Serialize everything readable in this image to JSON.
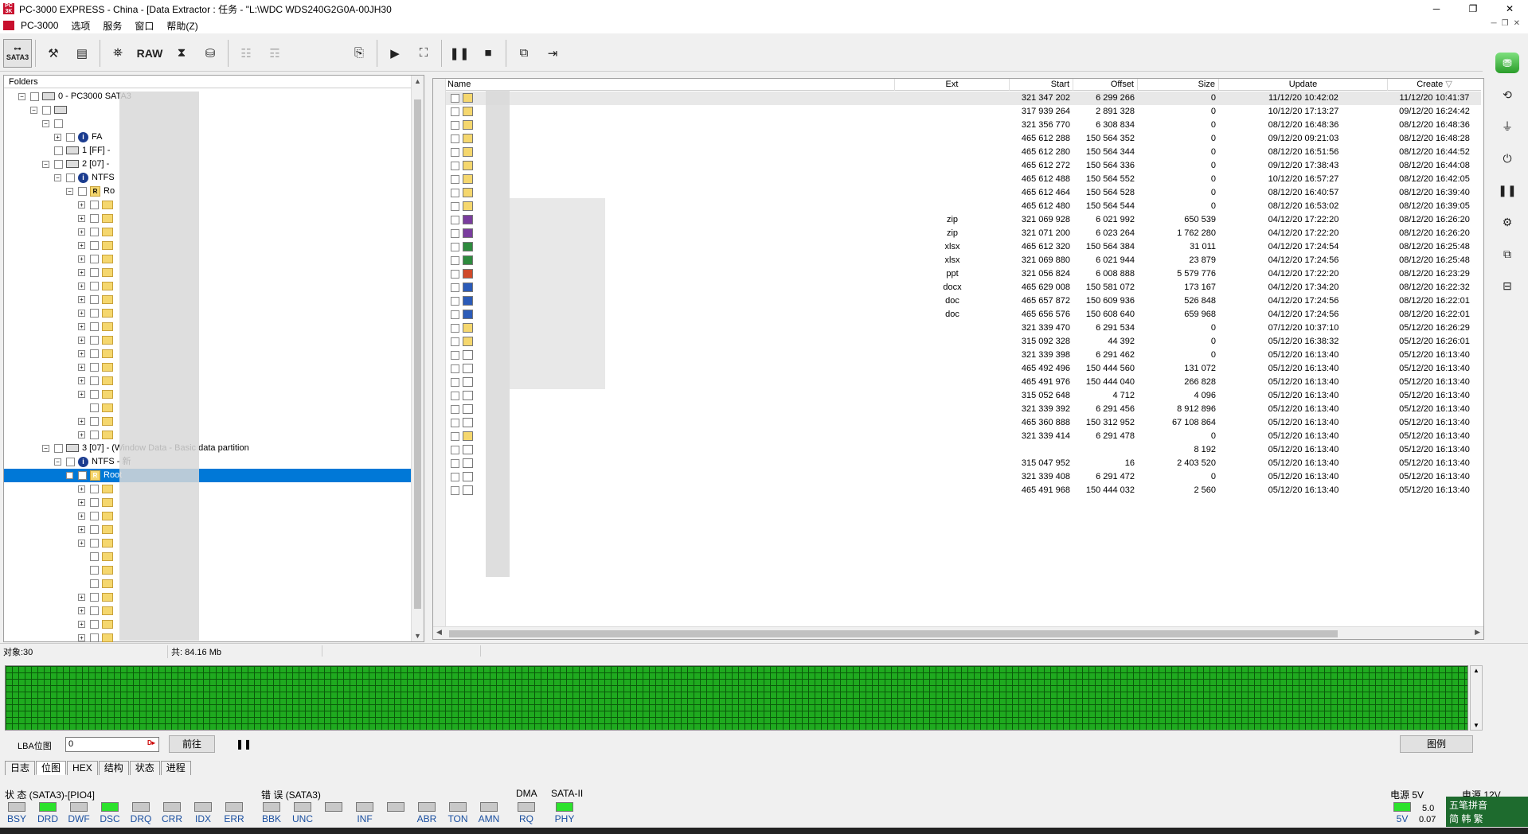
{
  "window": {
    "title": "PC-3000 EXPRESS - China - [Data Extractor : 任务 - \"L:\\WDC WDS240G2G0A-00JH30",
    "min": "─",
    "max": "❐",
    "close": "✕"
  },
  "menu": [
    "PC-3000",
    "选项",
    "服务",
    "窗口",
    "帮助(Z)"
  ],
  "toolbar": {
    "sata_label": "SATA3",
    "raw_label": "RAW"
  },
  "folders": {
    "header": "Folders",
    "rows": [
      {
        "text": "0 - PC3000 SATA3",
        "depth": 0,
        "icon": "disk",
        "exp": "−"
      },
      {
        "text": "",
        "depth": 1,
        "icon": "disk",
        "exp": "−"
      },
      {
        "text": "",
        "depth": 2,
        "icon": "none",
        "exp": "−"
      },
      {
        "text": "FA",
        "depth": 3,
        "icon": "info",
        "exp": "+"
      },
      {
        "text": "1 [FF] -",
        "depth": 2,
        "icon": "disk",
        "exp": ""
      },
      {
        "text": "2 [07] -",
        "depth": 2,
        "icon": "disk",
        "exp": "−"
      },
      {
        "text": "NTFS",
        "depth": 3,
        "icon": "info",
        "exp": "−"
      },
      {
        "text": "Ro",
        "depth": 4,
        "icon": "root",
        "exp": "−"
      }
    ],
    "partition3": "3 [07] - (Window",
    "partition3_tail": "Data - Basic data partition",
    "ntfs2": "NTFS - 新",
    "root_sel": "Root"
  },
  "filelist": {
    "columns": {
      "name": "Name",
      "ext": "Ext",
      "start": "Start",
      "offset": "Offset",
      "size": "Size",
      "update": "Update",
      "create": "Create"
    },
    "rows": [
      {
        "type": "folder",
        "ext": "",
        "start": "321 347 202",
        "offset": "6 299 266",
        "size": "0",
        "update": "11/12/20 10:42:02",
        "create": "11/12/20 10:41:37"
      },
      {
        "type": "folder",
        "ext": "",
        "start": "317 939 264",
        "offset": "2 891 328",
        "size": "0",
        "update": "10/12/20 17:13:27",
        "create": "09/12/20 16:24:42"
      },
      {
        "type": "folder",
        "ext": "",
        "start": "321 356 770",
        "offset": "6 308 834",
        "size": "0",
        "update": "08/12/20 16:48:36",
        "create": "08/12/20 16:48:36"
      },
      {
        "type": "folder",
        "ext": "",
        "start": "465 612 288",
        "offset": "150 564 352",
        "size": "0",
        "update": "09/12/20 09:21:03",
        "create": "08/12/20 16:48:28"
      },
      {
        "type": "folder",
        "ext": "",
        "start": "465 612 280",
        "offset": "150 564 344",
        "size": "0",
        "update": "08/12/20 16:51:56",
        "create": "08/12/20 16:44:52"
      },
      {
        "type": "folder",
        "ext": "",
        "start": "465 612 272",
        "offset": "150 564 336",
        "size": "0",
        "update": "09/12/20 17:38:43",
        "create": "08/12/20 16:44:08"
      },
      {
        "type": "folder",
        "ext": "",
        "start": "465 612 488",
        "offset": "150 564 552",
        "size": "0",
        "update": "10/12/20 16:57:27",
        "create": "08/12/20 16:42:05"
      },
      {
        "type": "folder",
        "ext": "",
        "start": "465 612 464",
        "offset": "150 564 528",
        "size": "0",
        "update": "08/12/20 16:40:57",
        "create": "08/12/20 16:39:40"
      },
      {
        "type": "folder",
        "ext": "",
        "start": "465 612 480",
        "offset": "150 564 544",
        "size": "0",
        "update": "08/12/20 16:53:02",
        "create": "08/12/20 16:39:05"
      },
      {
        "type": "zip",
        "ext": "zip",
        "start": "321 069 928",
        "offset": "6 021 992",
        "size": "650 539",
        "update": "04/12/20 17:22:20",
        "create": "08/12/20 16:26:20"
      },
      {
        "type": "zip",
        "ext": "zip",
        "start": "321 071 200",
        "offset": "6 023 264",
        "size": "1 762 280",
        "update": "04/12/20 17:22:20",
        "create": "08/12/20 16:26:20"
      },
      {
        "type": "xls",
        "ext": "xlsx",
        "start": "465 612 320",
        "offset": "150 564 384",
        "size": "31 011",
        "update": "04/12/20 17:24:54",
        "create": "08/12/20 16:25:48"
      },
      {
        "type": "xls",
        "ext": "xlsx",
        "start": "321 069 880",
        "offset": "6 021 944",
        "size": "23 879",
        "update": "04/12/20 17:24:56",
        "create": "08/12/20 16:25:48"
      },
      {
        "type": "ppt",
        "ext": "ppt",
        "start": "321 056 824",
        "offset": "6 008 888",
        "size": "5 579 776",
        "update": "04/12/20 17:22:20",
        "create": "08/12/20 16:23:29"
      },
      {
        "type": "doc",
        "ext": "docx",
        "start": "465 629 008",
        "offset": "150 581 072",
        "size": "173 167",
        "update": "04/12/20 17:34:20",
        "create": "08/12/20 16:22:32"
      },
      {
        "type": "doc",
        "ext": "doc",
        "start": "465 657 872",
        "offset": "150 609 936",
        "size": "526 848",
        "update": "04/12/20 17:24:56",
        "create": "08/12/20 16:22:01"
      },
      {
        "type": "doc",
        "ext": "doc",
        "start": "465 656 576",
        "offset": "150 608 640",
        "size": "659 968",
        "update": "04/12/20 17:24:56",
        "create": "08/12/20 16:22:01"
      },
      {
        "type": "folder",
        "ext": "",
        "start": "321 339 470",
        "offset": "6 291 534",
        "size": "0",
        "update": "07/12/20 10:37:10",
        "create": "05/12/20 16:26:29"
      },
      {
        "type": "folder",
        "ext": "",
        "start": "315 092 328",
        "offset": "44 392",
        "size": "0",
        "update": "05/12/20 16:38:32",
        "create": "05/12/20 16:26:01"
      },
      {
        "type": "file",
        "ext": "",
        "start": "321 339 398",
        "offset": "6 291 462",
        "size": "0",
        "update": "05/12/20 16:13:40",
        "create": "05/12/20 16:13:40"
      },
      {
        "type": "file",
        "ext": "",
        "start": "465 492 496",
        "offset": "150 444 560",
        "size": "131 072",
        "update": "05/12/20 16:13:40",
        "create": "05/12/20 16:13:40"
      },
      {
        "type": "file",
        "ext": "",
        "start": "465 491 976",
        "offset": "150 444 040",
        "size": "266 828",
        "update": "05/12/20 16:13:40",
        "create": "05/12/20 16:13:40"
      },
      {
        "type": "file",
        "ext": "",
        "start": "315 052 648",
        "offset": "4 712",
        "size": "4 096",
        "update": "05/12/20 16:13:40",
        "create": "05/12/20 16:13:40"
      },
      {
        "type": "file",
        "ext": "",
        "start": "321 339 392",
        "offset": "6 291 456",
        "size": "8 912 896",
        "update": "05/12/20 16:13:40",
        "create": "05/12/20 16:13:40"
      },
      {
        "type": "file",
        "ext": "",
        "start": "465 360 888",
        "offset": "150 312 952",
        "size": "67 108 864",
        "update": "05/12/20 16:13:40",
        "create": "05/12/20 16:13:40"
      },
      {
        "type": "folder",
        "ext": "",
        "start": "321 339 414",
        "offset": "6 291 478",
        "size": "0",
        "update": "05/12/20 16:13:40",
        "create": "05/12/20 16:13:40"
      },
      {
        "type": "file",
        "ext": "",
        "start": "",
        "offset": "",
        "size": "8 192",
        "update": "05/12/20 16:13:40",
        "create": "05/12/20 16:13:40"
      },
      {
        "type": "file",
        "ext": "",
        "start": "315 047 952",
        "offset": "16",
        "size": "2 403 520",
        "update": "05/12/20 16:13:40",
        "create": "05/12/20 16:13:40"
      },
      {
        "type": "file",
        "ext": "",
        "start": "321 339 408",
        "offset": "6 291 472",
        "size": "0",
        "update": "05/12/20 16:13:40",
        "create": "05/12/20 16:13:40"
      },
      {
        "type": "file",
        "ext": "",
        "start": "465 491 968",
        "offset": "150 444 032",
        "size": "2 560",
        "update": "05/12/20 16:13:40",
        "create": "05/12/20 16:13:40"
      }
    ]
  },
  "statusline": {
    "objects": "对象:30",
    "total": "共: 84.16 Mb"
  },
  "lba": {
    "label": "LBA位图",
    "value": "0",
    "go": "前往",
    "legend": "图例"
  },
  "tabs": [
    "日志",
    "位图",
    "HEX",
    "结构",
    "状态",
    "进程"
  ],
  "status_group": {
    "title": "状 态 (SATA3)-[PIO4]",
    "leds": [
      {
        "l": "BSY",
        "on": false
      },
      {
        "l": "DRD",
        "on": true
      },
      {
        "l": "DWF",
        "on": false
      },
      {
        "l": "DSC",
        "on": true
      },
      {
        "l": "DRQ",
        "on": false
      },
      {
        "l": "CRR",
        "on": false
      },
      {
        "l": "IDX",
        "on": false
      },
      {
        "l": "ERR",
        "on": false
      }
    ]
  },
  "error_group": {
    "title": "错 误 (SATA3)",
    "leds": [
      {
        "l": "BBK",
        "on": false
      },
      {
        "l": "UNC",
        "on": false
      },
      {
        "l": "",
        "on": false
      },
      {
        "l": "INF",
        "on": false
      },
      {
        "l": "",
        "on": false
      },
      {
        "l": "ABR",
        "on": false
      },
      {
        "l": "TON",
        "on": false
      },
      {
        "l": "AMN",
        "on": false
      }
    ]
  },
  "dma_group": {
    "title": "DMA",
    "leds": [
      {
        "l": "RQ",
        "on": false
      }
    ]
  },
  "sata2_group": {
    "title": "SATA-II",
    "leds": [
      {
        "l": "PHY",
        "on": true
      }
    ]
  },
  "power5": {
    "title": "电源 5V",
    "led": "5V",
    "v1": "5.0",
    "v2": "0.07"
  },
  "power12": {
    "title": "电源 12V"
  },
  "ime": {
    "line1": "五笔拼音",
    "line2": "简 韩 繁"
  },
  "colors": {
    "selection": "#0078d7",
    "led_on": "#2ce22c",
    "sector_ok": "#1faa1f"
  }
}
